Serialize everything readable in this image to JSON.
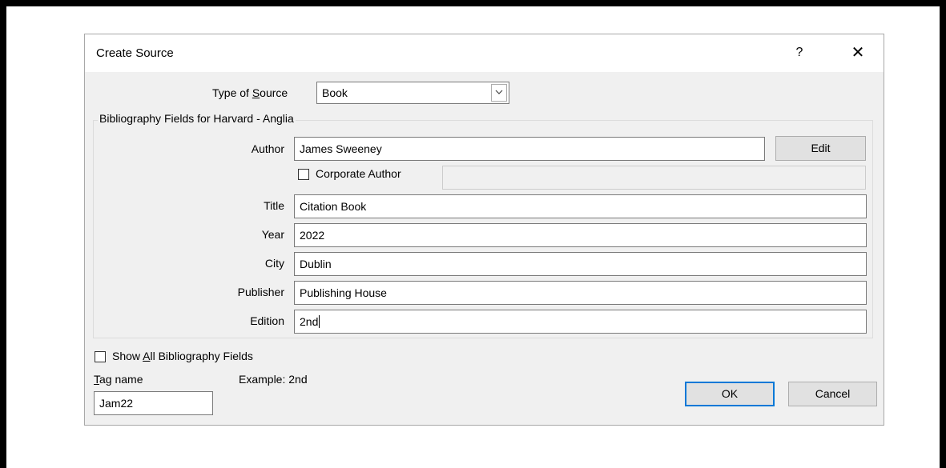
{
  "dialog": {
    "title": "Create Source",
    "help_label": "?",
    "close_label": "✕"
  },
  "type_of_source": {
    "label_pre": "Type of ",
    "label_key": "S",
    "label_post": "ource",
    "value": "Book"
  },
  "group": {
    "title": "Bibliography Fields for Harvard - Anglia"
  },
  "fields": {
    "author": {
      "label": "Author",
      "value": "James Sweeney"
    },
    "corporate_author": {
      "label": "Corporate Author",
      "checked": false,
      "value": ""
    },
    "title": {
      "label": "Title",
      "value": "Citation Book"
    },
    "year": {
      "label": "Year",
      "value": "2022"
    },
    "city": {
      "label": "City",
      "value": "Dublin"
    },
    "publisher": {
      "label": "Publisher",
      "value": "Publishing House"
    },
    "edition": {
      "label": "Edition",
      "value": "2nd"
    }
  },
  "buttons": {
    "edit": "Edit",
    "ok": "OK",
    "cancel": "Cancel"
  },
  "show_all": {
    "label_pre": "Show ",
    "label_key": "A",
    "label_post": "ll Bibliography Fields",
    "checked": false
  },
  "tag": {
    "label_key": "T",
    "label_post": "ag name",
    "value": "Jam22"
  },
  "example": {
    "text": "Example: 2nd"
  },
  "colors": {
    "dialog_bg": "#f0f0f0",
    "default_button_border": "#0078d7",
    "button_bg": "#e1e1e1"
  }
}
